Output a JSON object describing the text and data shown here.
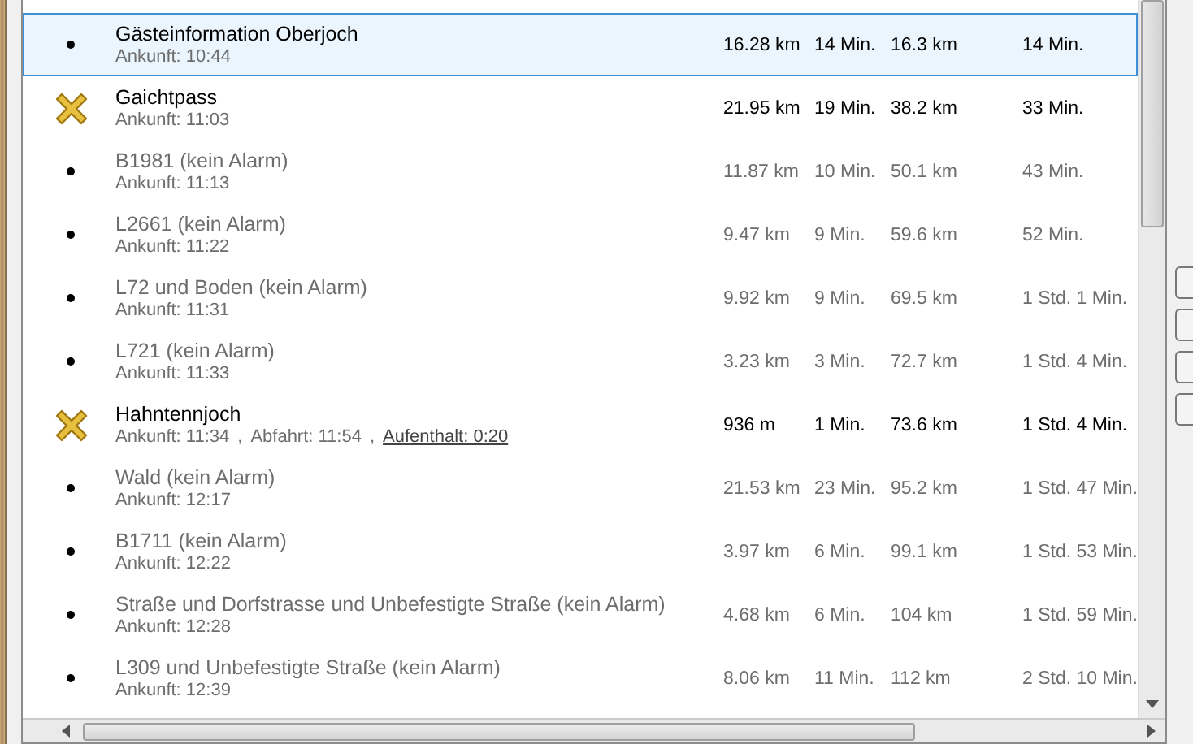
{
  "rows": [
    {
      "kind": "waypoint",
      "selected": true,
      "name": "Gästeinformation Oberjoch",
      "details": [
        {
          "text": "Ankunft: 10:44",
          "link": false
        }
      ],
      "distance": "16.28 km",
      "duration": "14 Min.",
      "total_distance": "16.3 km",
      "total_duration": "14 Min."
    },
    {
      "kind": "stop",
      "selected": false,
      "name": "Gaichtpass",
      "details": [
        {
          "text": "Ankunft: 11:03",
          "link": false
        }
      ],
      "distance": "21.95 km",
      "duration": "19 Min.",
      "total_distance": "38.2 km",
      "total_duration": "33 Min."
    },
    {
      "kind": "waypoint",
      "selected": false,
      "name": "B1981 (kein Alarm)",
      "details": [
        {
          "text": "Ankunft: 11:13",
          "link": false
        }
      ],
      "distance": "11.87 km",
      "duration": "10 Min.",
      "total_distance": "50.1 km",
      "total_duration": "43 Min."
    },
    {
      "kind": "waypoint",
      "selected": false,
      "name": "L2661 (kein Alarm)",
      "details": [
        {
          "text": "Ankunft: 11:22",
          "link": false
        }
      ],
      "distance": "9.47 km",
      "duration": "9 Min.",
      "total_distance": "59.6 km",
      "total_duration": "52 Min."
    },
    {
      "kind": "waypoint",
      "selected": false,
      "name": "L72 und Boden (kein Alarm)",
      "details": [
        {
          "text": "Ankunft: 11:31",
          "link": false
        }
      ],
      "distance": "9.92 km",
      "duration": "9 Min.",
      "total_distance": "69.5 km",
      "total_duration": "1 Std. 1 Min."
    },
    {
      "kind": "waypoint",
      "selected": false,
      "name": "L721 (kein Alarm)",
      "details": [
        {
          "text": "Ankunft: 11:33",
          "link": false
        }
      ],
      "distance": "3.23 km",
      "duration": "3 Min.",
      "total_distance": "72.7 km",
      "total_duration": "1 Std. 4 Min."
    },
    {
      "kind": "stop",
      "selected": false,
      "name": "Hahntennjoch",
      "details": [
        {
          "text": "Ankunft: 11:34",
          "link": false
        },
        {
          "text": "Abfahrt: 11:54",
          "link": false
        },
        {
          "text": "Aufenthalt: 0:20",
          "link": true
        }
      ],
      "distance": "936 m",
      "duration": "1 Min.",
      "total_distance": "73.6 km",
      "total_duration": "1 Std. 4 Min."
    },
    {
      "kind": "waypoint",
      "selected": false,
      "name": "Wald (kein Alarm)",
      "details": [
        {
          "text": "Ankunft: 12:17",
          "link": false
        }
      ],
      "distance": "21.53 km",
      "duration": "23 Min.",
      "total_distance": "95.2 km",
      "total_duration": "1 Std. 47 Min."
    },
    {
      "kind": "waypoint",
      "selected": false,
      "name": "B1711 (kein Alarm)",
      "details": [
        {
          "text": "Ankunft: 12:22",
          "link": false
        }
      ],
      "distance": "3.97 km",
      "duration": "6 Min.",
      "total_distance": "99.1 km",
      "total_duration": "1 Std. 53 Min."
    },
    {
      "kind": "waypoint",
      "selected": false,
      "name": "Straße und Dorfstrasse und Unbefestigte Straße (kein Alarm)",
      "details": [
        {
          "text": "Ankunft: 12:28",
          "link": false
        }
      ],
      "distance": "4.68 km",
      "duration": "6 Min.",
      "total_distance": "104 km",
      "total_duration": "1 Std. 59 Min."
    },
    {
      "kind": "waypoint",
      "selected": false,
      "name": "L309 und Unbefestigte Straße (kein Alarm)",
      "details": [
        {
          "text": "Ankunft: 12:39",
          "link": false
        }
      ],
      "distance": "8.06 km",
      "duration": "11 Min.",
      "total_distance": "112 km",
      "total_duration": "2 Std. 10 Min."
    }
  ],
  "separator": ","
}
